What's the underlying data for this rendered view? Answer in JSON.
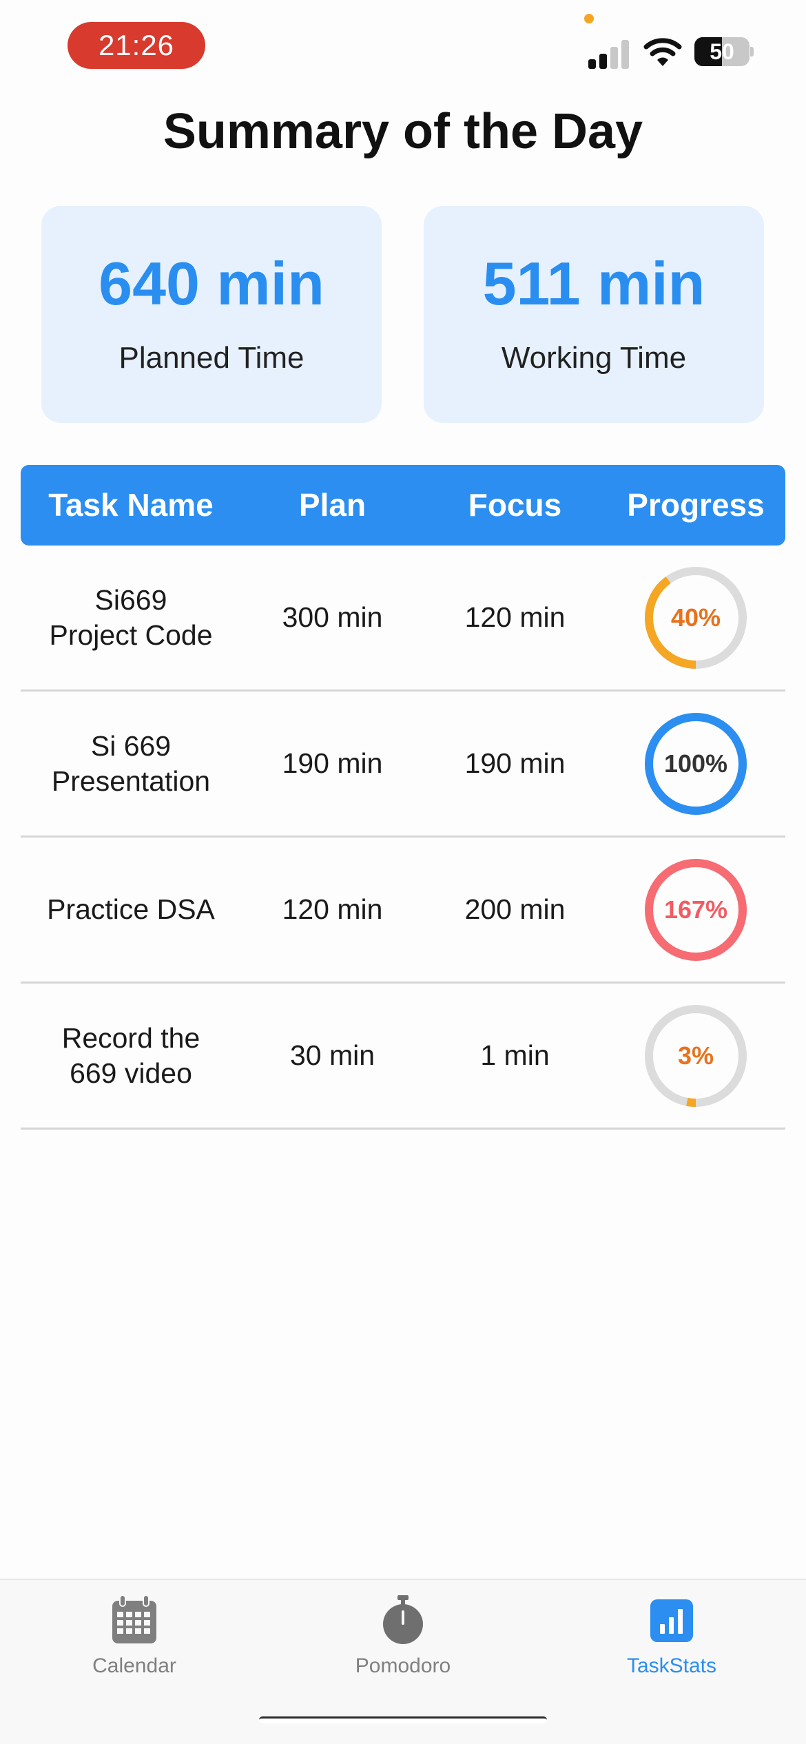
{
  "status_bar": {
    "time": "21:26",
    "battery_percent": 50,
    "battery_label": "50",
    "signal_bars_active": 2
  },
  "title": "Summary of the Day",
  "summary": {
    "planned": {
      "value": "640 min",
      "label": "Planned Time"
    },
    "working": {
      "value": "511 min",
      "label": "Working Time"
    }
  },
  "table": {
    "headers": {
      "name": "Task Name",
      "plan": "Plan",
      "focus": "Focus",
      "progress": "Progress"
    },
    "rows": [
      {
        "name": "Si669\nProject Code",
        "plan": "300 min",
        "focus": "120 min",
        "progress_label": "40%",
        "progress": 0.4,
        "ring_color": "#f5a623",
        "text_color": "#e8721c"
      },
      {
        "name": "Si 669\nPresentation",
        "plan": "190 min",
        "focus": "190 min",
        "progress_label": "100%",
        "progress": 1.0,
        "ring_color": "#2b8ef0",
        "text_color": "#333333"
      },
      {
        "name": "Practice DSA",
        "plan": "120 min",
        "focus": "200 min",
        "progress_label": "167%",
        "progress": 1.67,
        "ring_color": "#f76b72",
        "text_color": "#f25b63"
      },
      {
        "name": "Record the\n669 video",
        "plan": "30 min",
        "focus": "1 min",
        "progress_label": "3%",
        "progress": 0.03,
        "ring_color": "#f5a623",
        "text_color": "#e8721c"
      }
    ]
  },
  "tabs": [
    {
      "label": "Calendar",
      "icon": "calendar-icon",
      "active": false
    },
    {
      "label": "Pomodoro",
      "icon": "stopwatch-icon",
      "active": false
    },
    {
      "label": "TaskStats",
      "icon": "bar-chart-icon",
      "active": true
    }
  ],
  "colors": {
    "accent": "#2b8ef0",
    "card_background": "#e6f1fd",
    "ring_track": "#dcdcdc",
    "inactive_tab": "#808080"
  }
}
